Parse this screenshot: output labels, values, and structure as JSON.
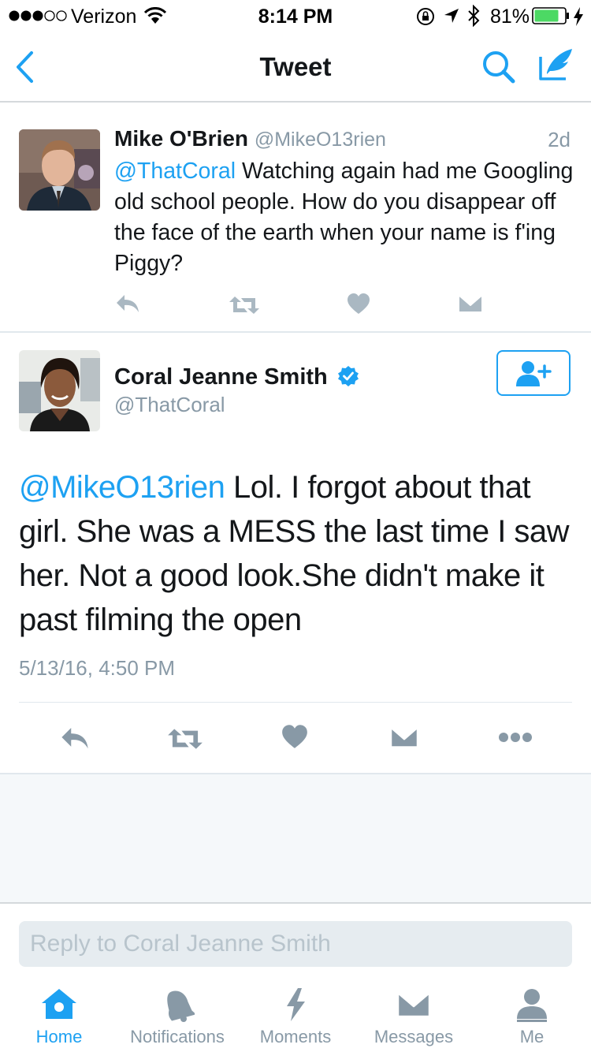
{
  "status_bar": {
    "carrier": "Verizon",
    "time": "8:14 PM",
    "battery": "81%",
    "battery_level": 0.81
  },
  "nav": {
    "title": "Tweet"
  },
  "tweet1": {
    "author_name": "Mike O'Brien",
    "author_handle": "@MikeO13rien",
    "time_ago": "2d",
    "mention": "@ThatCoral",
    "text": " Watching again had me Googling old school people. How do you disappear off the face of the earth when your name is f'ing Piggy?"
  },
  "tweet2": {
    "author_name": "Coral Jeanne Smith",
    "author_handle": "@ThatCoral",
    "mention": "@MikeO13rien",
    "text": " Lol. I forgot about that girl. She was a MESS the last time I saw her. Not a good look.She didn't make it past filming the open",
    "timestamp": "5/13/16, 4:50 PM"
  },
  "reply": {
    "placeholder": "Reply to Coral Jeanne Smith"
  },
  "tabbar": {
    "tabs": [
      {
        "label": "Home"
      },
      {
        "label": "Notifications"
      },
      {
        "label": "Moments"
      },
      {
        "label": "Messages"
      },
      {
        "label": "Me"
      }
    ]
  },
  "colors": {
    "accent": "#1da1f2",
    "muted": "#8899a6",
    "action_icon": "#aab8c2",
    "battery": "#4cd964"
  },
  "icons": [
    "signal-dots-icon",
    "wifi-icon",
    "lock-rotation-icon",
    "location-arrow-icon",
    "bluetooth-icon",
    "battery-icon",
    "charging-icon",
    "back-chevron-icon",
    "search-icon",
    "compose-icon",
    "reply-icon",
    "retweet-icon",
    "like-icon",
    "direct-message-icon",
    "more-icon",
    "verified-icon",
    "follow-icon",
    "home-icon",
    "notifications-icon",
    "moments-icon",
    "messages-icon",
    "me-icon"
  ]
}
